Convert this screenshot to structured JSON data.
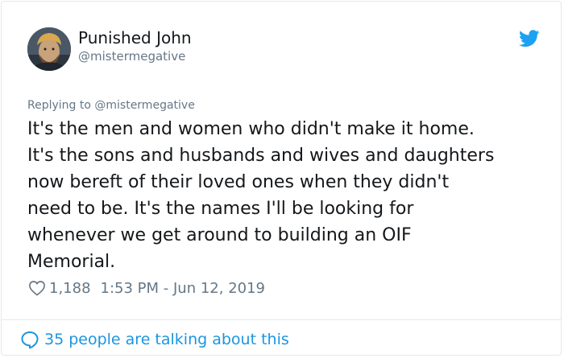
{
  "colors": {
    "link_blue": "#1b95e0",
    "twitter_blue": "#1da1f2",
    "secondary_text": "#657786",
    "primary_text": "#14171a",
    "border": "#e1e8ed"
  },
  "author": {
    "name": "Punished John",
    "handle": "@mistermegative",
    "avatar_icon": "avatar-photo"
  },
  "brand_icon": "twitter-bird-icon",
  "reply": {
    "text": "Replying to @mistermegative"
  },
  "tweet": {
    "lines": [
      "It's the men and women who didn't make it home.",
      "It's the sons and husbands and wives and daughters",
      "now bereft of their loved ones when they didn't",
      "need to be. It's the names I'll be looking for",
      "whenever we get around to building an OIF",
      "Memorial."
    ]
  },
  "meta": {
    "likes": "1,188",
    "timestamp": "1:53 PM - Jun 12, 2019",
    "like_icon": "heart-icon"
  },
  "footer": {
    "talking_text": "35 people are talking about this",
    "icon": "speech-bubble-icon"
  }
}
